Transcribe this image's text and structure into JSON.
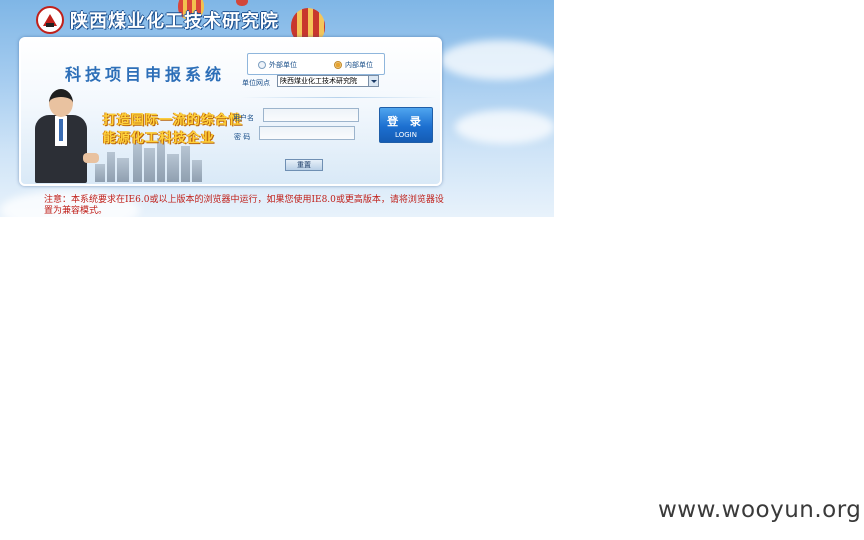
{
  "header": {
    "org_name": "陕西煤业化工技术研究院"
  },
  "login_panel": {
    "system_title": "科技项目申报系统",
    "slogan_line1": "打造国际一流的综合性",
    "slogan_line2": "能源化工科技企业",
    "unit_type": {
      "options": [
        "外部单位",
        "内部单位"
      ],
      "selected": "内部单位"
    },
    "unit_label": "单位网点",
    "unit_select_value": "陕西煤业化工技术研究院",
    "username_label": "用户名",
    "username_value": "",
    "password_label": "密 码",
    "password_value": "",
    "login_button": {
      "zh": "登 录",
      "en": "LOGIN"
    },
    "reset_button": "重置"
  },
  "notice": "注意：本系统要求在IE6.0或以上版本的浏览器中运行，如果您使用IE8.0或更高版本，请将浏览器设置为兼容模式。",
  "watermark": "www.wooyun.org",
  "colors": {
    "accent_blue": "#2d6fb8",
    "notice_red": "#c0201a",
    "slogan_gold": "#ffd23a",
    "login_button": "#1c6fd0"
  }
}
